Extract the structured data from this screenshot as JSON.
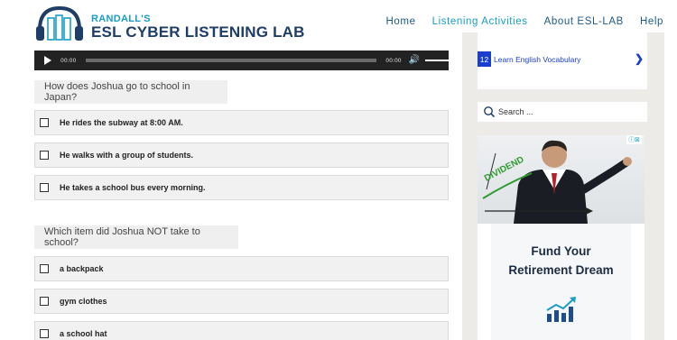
{
  "header": {
    "logo_small": "RANDALL'S",
    "logo_big": "ESL CYBER LISTENING LAB",
    "nav": [
      {
        "label": "Home",
        "active": false
      },
      {
        "label": "Listening Activities",
        "active": true
      },
      {
        "label": "About ESL-LAB",
        "active": false
      },
      {
        "label": "Help",
        "active": false
      }
    ]
  },
  "player": {
    "current_time": "00:00",
    "duration": "00:00",
    "progress": 0,
    "volume": 1
  },
  "quiz": [
    {
      "question": "How does Joshua go to school in Japan?",
      "options": [
        "He rides the subway at 8:00 AM.",
        "He walks with a group of students.",
        "He takes a school bus every morning."
      ]
    },
    {
      "question": "Which item did Joshua NOT take to school?",
      "options": [
        "a backpack",
        "gym clothes",
        "a school hat"
      ]
    }
  ],
  "sidebar": {
    "vocab_number": "12",
    "vocab_label": "Learn English Vocabulary",
    "search_placeholder": "Search ...",
    "ad": {
      "photo_text": "DIVIDEND",
      "title_line1": "Fund Your",
      "title_line2": "Retirement Dream"
    }
  },
  "colors": {
    "brand_navy": "#1e3e68",
    "brand_teal": "#1a9dc6",
    "link_blue": "#1a3fd0",
    "sidebar_bg": "#ecebe7"
  }
}
